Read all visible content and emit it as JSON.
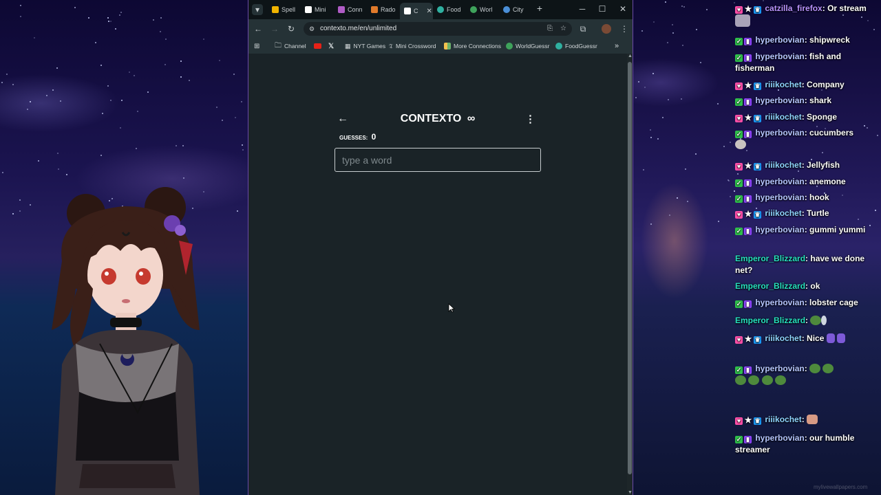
{
  "browser": {
    "tabs": [
      {
        "label": "Spell",
        "icon_color": "#f0b400"
      },
      {
        "label": "Mini",
        "icon_color": "#ffffff"
      },
      {
        "label": "Conn",
        "icon_color": "#b05cc6"
      },
      {
        "label": "Rado",
        "icon_color": "#e07a2b"
      },
      {
        "label": "C",
        "icon_color": "#ffffff",
        "active": true
      },
      {
        "label": "Food",
        "icon_color": "#2fb0a0"
      },
      {
        "label": "Worl",
        "icon_color": "#3ea35b"
      },
      {
        "label": "City",
        "icon_color": "#4a8fd8"
      }
    ],
    "new_tab_label": "+",
    "url": "contexto.me/en/unlimited",
    "bookmarks": [
      {
        "label": "Channel",
        "icon": "folder-icon"
      },
      {
        "label": "",
        "icon": "youtube-icon"
      },
      {
        "label": "",
        "icon": "x-icon"
      },
      {
        "label": "NYT Games",
        "icon": "nyt-icon"
      },
      {
        "label": "Mini Crossword",
        "icon": "nyt-icon"
      },
      {
        "label": "More Connections",
        "icon": "grid-icon"
      },
      {
        "label": "WorldGuessr",
        "icon": "globe-icon"
      },
      {
        "label": "FoodGuessr",
        "icon": "globe-icon"
      }
    ],
    "more_bookmarks_label": "»"
  },
  "contexto": {
    "title": "CONTEXTO",
    "infinity": "∞",
    "guesses_label": "GUESSES:",
    "guesses_count": "0",
    "input_placeholder": "type a word"
  },
  "chat": {
    "messages": [
      {
        "user": "catzilla_firefox",
        "text": "Or stream",
        "badges": [
          "heart",
          "star",
          "crown"
        ],
        "style": "default"
      },
      {
        "user": "hyperbovian",
        "text": "shipwreck",
        "badges": [
          "check",
          "prime"
        ],
        "style": "hyper"
      },
      {
        "user": "hyperbovian",
        "text": "fish and fisherman",
        "badges": [
          "check",
          "prime"
        ],
        "style": "hyper"
      },
      {
        "user": "riiikochet",
        "text": "Company",
        "badges": [
          "heart",
          "star",
          "crown"
        ],
        "style": "riii"
      },
      {
        "user": "hyperbovian",
        "text": "shark",
        "badges": [
          "check",
          "prime"
        ],
        "style": "hyper"
      },
      {
        "user": "riiikochet",
        "text": "Sponge",
        "badges": [
          "heart",
          "star",
          "crown"
        ],
        "style": "riii"
      },
      {
        "user": "hyperbovian",
        "text": "cucumbers",
        "badges": [
          "check",
          "prime"
        ],
        "style": "hyper"
      },
      {
        "user": "riiikochet",
        "text": "Jellyfish",
        "badges": [
          "heart",
          "star",
          "crown"
        ],
        "style": "riii"
      },
      {
        "user": "hyperbovian",
        "text": "anemone",
        "badges": [
          "check",
          "prime"
        ],
        "style": "hyper"
      },
      {
        "user": "hyperbovian",
        "text": "hook",
        "badges": [
          "check",
          "prime"
        ],
        "style": "hyper"
      },
      {
        "user": "riiikochet",
        "text": "Turtle",
        "badges": [
          "heart",
          "star",
          "crown"
        ],
        "style": "riii"
      },
      {
        "user": "hyperbovian",
        "text": "gummi yummi",
        "badges": [
          "check",
          "prime"
        ],
        "style": "hyper"
      },
      {
        "user": "Emperor_Blizzard",
        "text": "have we done net?",
        "badges": [],
        "style": "emp"
      },
      {
        "user": "Emperor_Blizzard",
        "text": "ok",
        "badges": [],
        "style": "emp"
      },
      {
        "user": "hyperbovian",
        "text": "lobster cage",
        "badges": [
          "check",
          "prime"
        ],
        "style": "hyper"
      },
      {
        "user": "Emperor_Blizzard",
        "text": "",
        "badges": [],
        "style": "emp"
      },
      {
        "user": "riiikochet",
        "text": "Nice",
        "badges": [
          "heart",
          "star",
          "crown"
        ],
        "style": "riii"
      },
      {
        "user": "hyperbovian",
        "text": "",
        "badges": [
          "check",
          "prime"
        ],
        "style": "hyper"
      },
      {
        "user": "riiikochet",
        "text": "",
        "badges": [
          "heart",
          "star",
          "crown"
        ],
        "style": "riii"
      },
      {
        "user": "hyperbovian",
        "text": "our humble streamer",
        "badges": [
          "check",
          "prime"
        ],
        "style": "hyper"
      }
    ],
    "watermark": "mylivewallpapers.com"
  }
}
